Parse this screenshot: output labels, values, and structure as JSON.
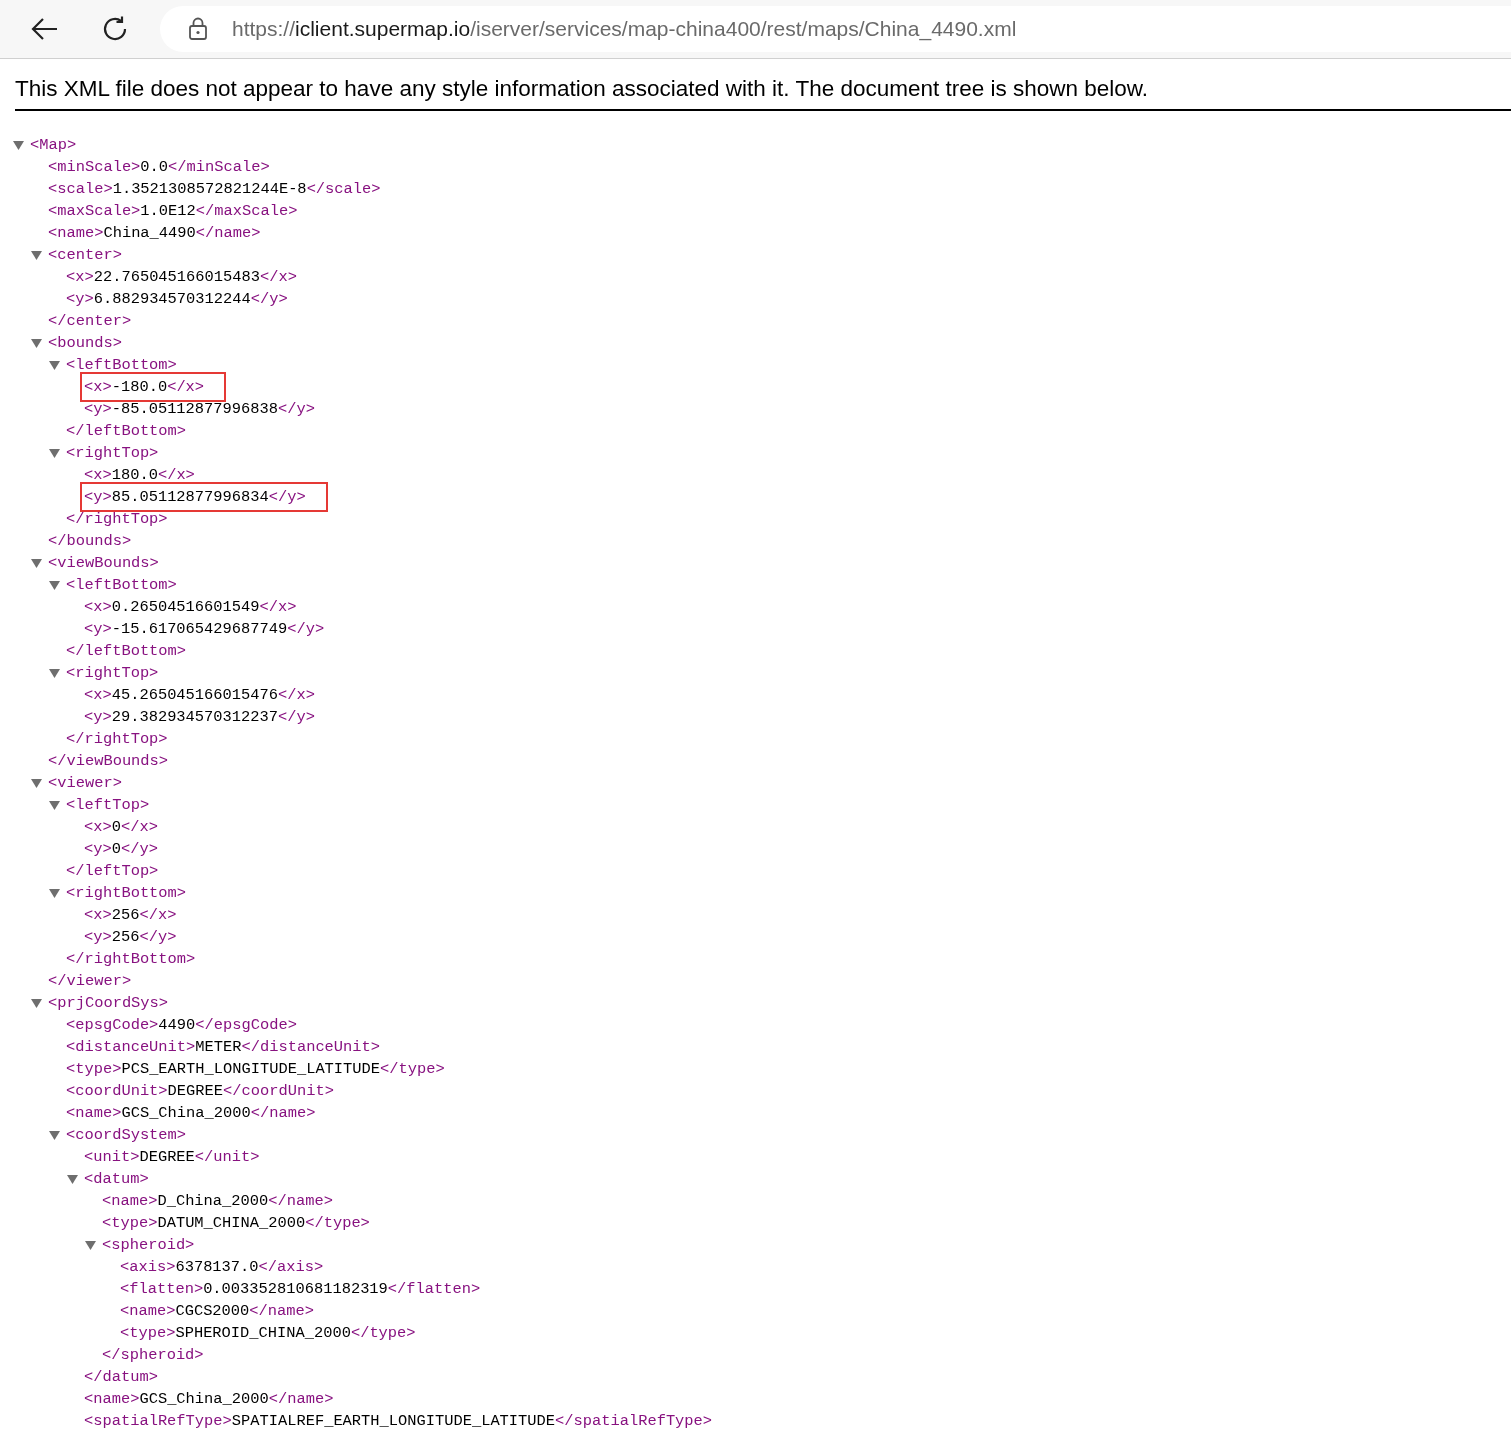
{
  "browser": {
    "url_scheme": "https://",
    "url_host": "iclient.supermap.io",
    "url_path": "/iserver/services/map-china400/rest/maps/China_4490.xml"
  },
  "info": "This XML file does not appear to have any style information associated with it. The document tree is shown below.",
  "tree": {
    "open": "<Map>",
    "expanded": true,
    "children": [
      {
        "open": "<minScale>",
        "value": "0.0",
        "close": "</minScale>"
      },
      {
        "open": "<scale>",
        "value": "1.3521308572821244E-8",
        "close": "</scale>"
      },
      {
        "open": "<maxScale>",
        "value": "1.0E12",
        "close": "</maxScale>"
      },
      {
        "open": "<name>",
        "value": "China_4490",
        "close": "</name>"
      },
      {
        "open": "<center>",
        "expanded": true,
        "close": "</center>",
        "children": [
          {
            "open": "<x>",
            "value": "22.765045166015483",
            "close": "</x>"
          },
          {
            "open": "<y>",
            "value": "6.882934570312244",
            "close": "</y>"
          }
        ]
      },
      {
        "open": "<bounds>",
        "expanded": true,
        "close": "</bounds>",
        "children": [
          {
            "open": "<leftBottom>",
            "expanded": true,
            "close": "</leftBottom>",
            "children": [
              {
                "open": "<x>",
                "value": "-180.0",
                "close": "</x>",
                "highlighted": true
              },
              {
                "open": "<y>",
                "value": "-85.05112877996838",
                "close": "</y>",
                "highlighted": false
              }
            ]
          },
          {
            "open": "<rightTop>",
            "expanded": true,
            "close": "</rightTop>",
            "children": [
              {
                "open": "<x>",
                "value": "180.0",
                "close": "</x>",
                "highlighted": false
              },
              {
                "open": "<y>",
                "value": "85.05112877996834",
                "close": "</y>",
                "highlighted": true
              }
            ]
          }
        ]
      },
      {
        "open": "<viewBounds>",
        "expanded": true,
        "close": "</viewBounds>",
        "children": [
          {
            "open": "<leftBottom>",
            "expanded": true,
            "close": "</leftBottom>",
            "children": [
              {
                "open": "<x>",
                "value": "0.26504516601549",
                "close": "</x>"
              },
              {
                "open": "<y>",
                "value": "-15.617065429687749",
                "close": "</y>"
              }
            ]
          },
          {
            "open": "<rightTop>",
            "expanded": true,
            "close": "</rightTop>",
            "children": [
              {
                "open": "<x>",
                "value": "45.265045166015476",
                "close": "</x>"
              },
              {
                "open": "<y>",
                "value": "29.382934570312237",
                "close": "</y>"
              }
            ]
          }
        ]
      },
      {
        "open": "<viewer>",
        "expanded": true,
        "close": "</viewer>",
        "children": [
          {
            "open": "<leftTop>",
            "expanded": true,
            "close": "</leftTop>",
            "children": [
              {
                "open": "<x>",
                "value": "0",
                "close": "</x>"
              },
              {
                "open": "<y>",
                "value": "0",
                "close": "</y>"
              }
            ]
          },
          {
            "open": "<rightBottom>",
            "expanded": true,
            "close": "</rightBottom>",
            "children": [
              {
                "open": "<x>",
                "value": "256",
                "close": "</x>"
              },
              {
                "open": "<y>",
                "value": "256",
                "close": "</y>"
              }
            ]
          }
        ]
      },
      {
        "open": "<prjCoordSys>",
        "expanded": true,
        "children": [
          {
            "open": "<epsgCode>",
            "value": "4490",
            "close": "</epsgCode>"
          },
          {
            "open": "<distanceUnit>",
            "value": "METER",
            "close": "</distanceUnit>"
          },
          {
            "open": "<type>",
            "value": "PCS_EARTH_LONGITUDE_LATITUDE",
            "close": "</type>"
          },
          {
            "open": "<coordUnit>",
            "value": "DEGREE",
            "close": "</coordUnit>"
          },
          {
            "open": "<name>",
            "value": "GCS_China_2000",
            "close": "</name>"
          },
          {
            "open": "<coordSystem>",
            "expanded": true,
            "children": [
              {
                "open": "<unit>",
                "value": "DEGREE",
                "close": "</unit>"
              },
              {
                "open": "<datum>",
                "expanded": true,
                "close": "</datum>",
                "children": [
                  {
                    "open": "<name>",
                    "value": "D_China_2000",
                    "close": "</name>"
                  },
                  {
                    "open": "<type>",
                    "value": "DATUM_CHINA_2000",
                    "close": "</type>"
                  },
                  {
                    "open": "<spheroid>",
                    "expanded": true,
                    "close": "</spheroid>",
                    "children": [
                      {
                        "open": "<axis>",
                        "value": "6378137.0",
                        "close": "</axis>"
                      },
                      {
                        "open": "<flatten>",
                        "value": "0.003352810681182319",
                        "close": "</flatten>"
                      },
                      {
                        "open": "<name>",
                        "value": "CGCS2000",
                        "close": "</name>"
                      },
                      {
                        "open": "<type>",
                        "value": "SPHEROID_CHINA_2000",
                        "close": "</type>"
                      }
                    ]
                  }
                ]
              },
              {
                "open": "<name>",
                "value": "GCS_China_2000",
                "close": "</name>"
              },
              {
                "open": "<spatialRefType>",
                "value": "SPATIALREF_EARTH_LONGITUDE_LATITUDE",
                "close": "</spatialRefType>"
              }
            ]
          }
        ]
      }
    ]
  }
}
